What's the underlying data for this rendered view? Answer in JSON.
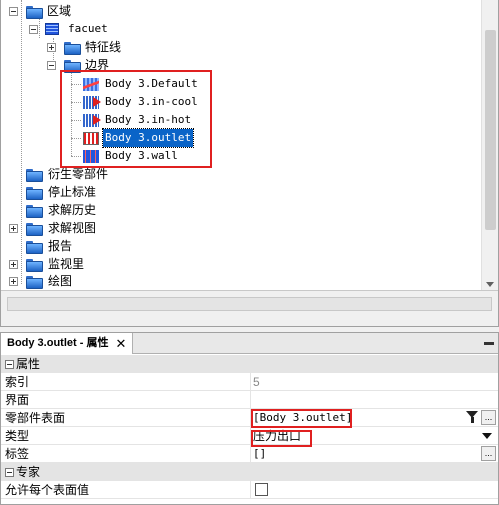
{
  "tree": {
    "region_label": "区域",
    "facuet_label": "facuet",
    "feature_line_label": "特征线",
    "boundaries_label": "边界",
    "boundaries": [
      {
        "label": "Body 3.Default",
        "icon": "wave-surface-icon"
      },
      {
        "label": "Body 3.in-cool",
        "icon": "inlet-arrow-icon"
      },
      {
        "label": "Body 3.in-hot",
        "icon": "inlet-arrow-icon"
      },
      {
        "label": "Body 3.outlet",
        "icon": "outlet-icon",
        "selected": true
      },
      {
        "label": "Body 3.wall",
        "icon": "wall-icon"
      }
    ],
    "root_items": [
      "衍生零部件",
      "停止标准",
      "求解历史",
      "求解视图",
      "报告",
      "监视里",
      "绘图"
    ]
  },
  "properties": {
    "tab_title": "Body 3.outlet - 属性",
    "close_symbol": "✕",
    "attributes_category": "属性",
    "index_label": "索引",
    "index_value": "5",
    "interface_label": "界面",
    "part_surface_label": "零部件表面",
    "part_surface_value": "[Body 3.outlet]",
    "ellipsis": "...",
    "type_label": "类型",
    "type_value": "压力出口",
    "tags_label": "标签",
    "tags_value": "[]",
    "expert_category": "专家",
    "allow_per_surface_label": "允许每个表面值"
  },
  "colors": {
    "selection": "#0a64c8",
    "highlight_box": "#e02020",
    "folder": "#2f6cc9"
  }
}
